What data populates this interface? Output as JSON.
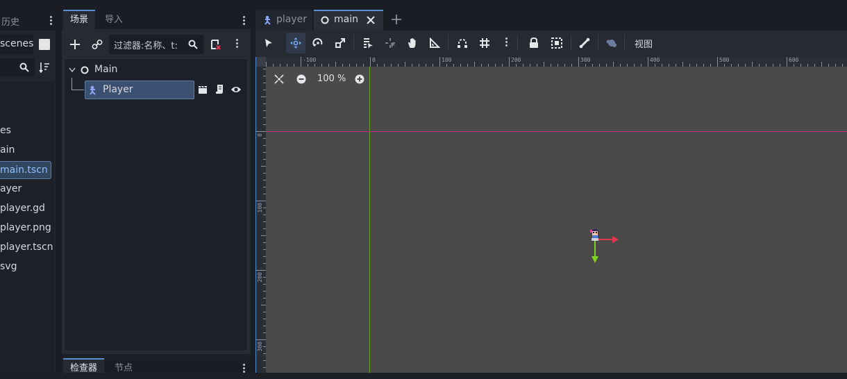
{
  "left_panel": {
    "tab_history": "历史",
    "path_field": "scenes",
    "files": [
      {
        "label": "es",
        "selected": false
      },
      {
        "label": "ain",
        "selected": false
      },
      {
        "label": "main.tscn",
        "selected": true
      },
      {
        "label": "ayer",
        "selected": false
      },
      {
        "label": "player.gd",
        "selected": false
      },
      {
        "label": "player.png",
        "selected": false
      },
      {
        "label": "player.tscn",
        "selected": false
      },
      {
        "label": "svg",
        "selected": false
      }
    ]
  },
  "scene_dock": {
    "tabs": [
      "场景",
      "导入"
    ],
    "active_tab": "场景",
    "filter_placeholder": "过滤器:名称、t:",
    "tree": {
      "root": "Main",
      "child": "Player"
    }
  },
  "inspector_dock": {
    "tabs": [
      "检查器",
      "节点"
    ]
  },
  "editor": {
    "tabs": [
      {
        "label": "player",
        "active": false
      },
      {
        "label": "main",
        "active": true
      }
    ],
    "view_menu": "视图",
    "zoom": "100 %"
  },
  "rulers": {
    "top": [
      "-100",
      "0",
      "100",
      "200",
      "300",
      "400",
      "500",
      "600"
    ],
    "left": [
      "0",
      "100",
      "200",
      "300"
    ]
  },
  "colors": {
    "accent": "#5a8fd6",
    "viewport_bg": "#4a4a4a",
    "x_axis": "#c02d7c",
    "y_axis": "#6ba62d",
    "gizmo_x": "#e5384f",
    "gizmo_y": "#7ed321",
    "selection": "#3b5070"
  }
}
